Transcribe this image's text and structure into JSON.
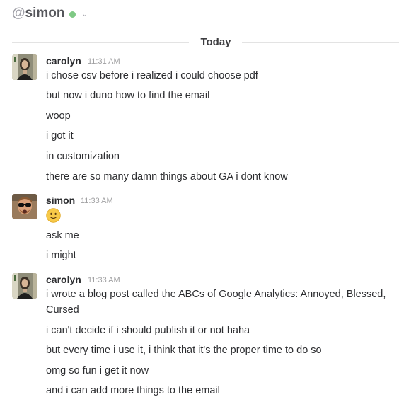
{
  "header": {
    "at_sign": "@",
    "channel": "simon"
  },
  "day_divider": "Today",
  "groups": [
    {
      "user": "carolyn",
      "time": "11:31 AM",
      "messages": [
        "i chose csv before i realized i could choose pdf",
        "but now i duno how to find the email",
        "woop",
        "i got it",
        "in customization",
        "there are so many damn things about GA i dont know"
      ]
    },
    {
      "user": "simon",
      "time": "11:33 AM",
      "messages": [
        "ask me",
        "i might"
      ]
    },
    {
      "user": "carolyn",
      "time": "11:33 AM",
      "messages": [
        "i wrote a blog post called the ABCs of Google Analytics: Annoyed, Blessed, Cursed",
        "i can't decide if i should publish it or not haha",
        "but every time i use it, i think that it's the proper time to do so",
        "omg so fun i get it now",
        "and i can add more things to the email"
      ]
    }
  ]
}
